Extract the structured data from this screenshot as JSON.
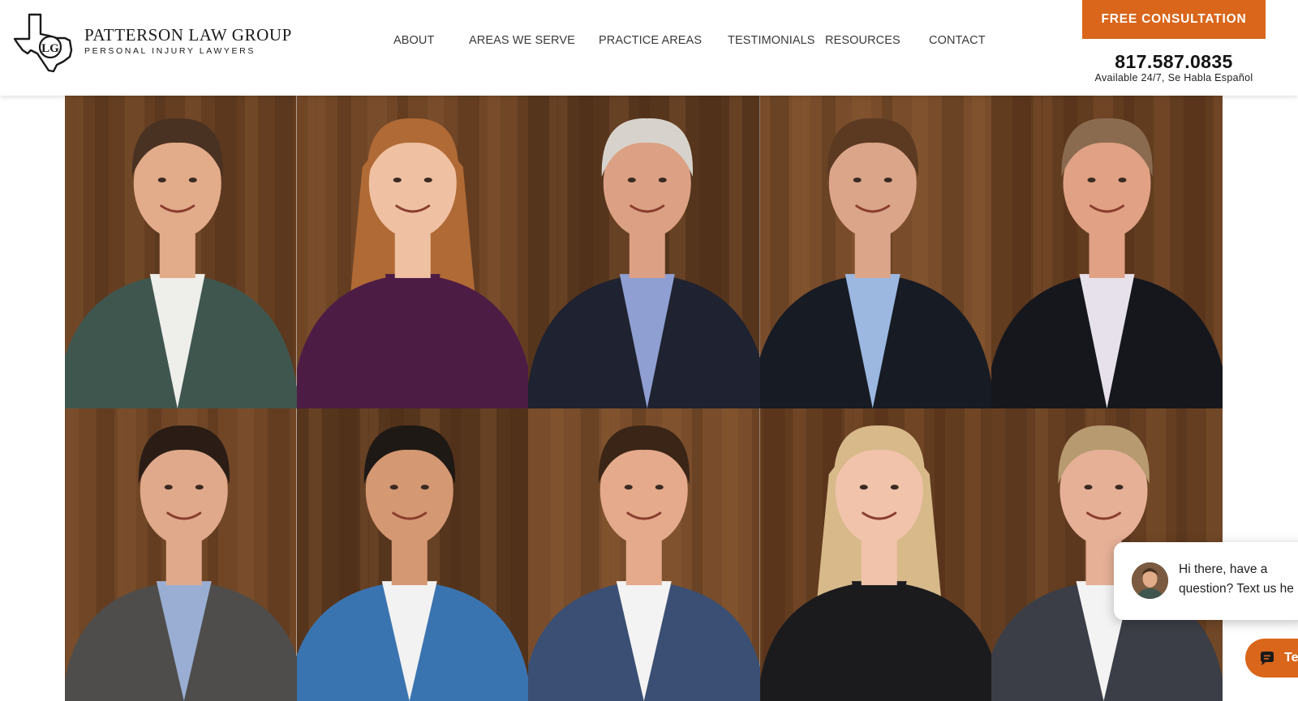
{
  "brand": {
    "name": "PATTERSON LAW GROUP",
    "tagline": "PERSONAL INJURY LAWYERS",
    "logo_monogram": "LG",
    "accent_color": "#d9661a"
  },
  "nav": {
    "items": [
      {
        "label": "ABOUT"
      },
      {
        "label": "AREAS WE SERVE"
      },
      {
        "label": "PRACTICE AREAS"
      },
      {
        "label": "TESTIMONIALS"
      },
      {
        "label": "RESOURCES"
      },
      {
        "label": "CONTACT"
      }
    ]
  },
  "header_cta": {
    "consult_label": "FREE CONSULTATION",
    "phone": "817.587.0835",
    "availability": "Available 24/7, Se Habla Español"
  },
  "team": {
    "photos": [
      {
        "suit": "#3f564f",
        "shirt": "#eeeeea",
        "hair": "#4a3222",
        "skin": "#e2ab8a",
        "long_hair": false
      },
      {
        "suit": "#4d1c45",
        "shirt": "#4d1c45",
        "hair": "#b06a35",
        "skin": "#efc1a2",
        "long_hair": true
      },
      {
        "suit": "#1f2230",
        "shirt": "#8f9fd2",
        "hair": "#d7d3cc",
        "skin": "#dca184",
        "long_hair": false
      },
      {
        "suit": "#161b24",
        "shirt": "#9cb8e1",
        "hair": "#5c3a22",
        "skin": "#dba58a",
        "long_hair": false
      },
      {
        "suit": "#15171d",
        "shirt": "#e6e1ea",
        "hair": "#8b6b4f",
        "skin": "#e0a184",
        "long_hair": false
      },
      {
        "suit": "#4f4d4b",
        "shirt": "#9aaed3",
        "hair": "#2b1d15",
        "skin": "#e0a98c",
        "long_hair": false
      },
      {
        "suit": "#3a74b0",
        "shirt": "#f2f2f2",
        "hair": "#1f1915",
        "skin": "#d49873",
        "long_hair": false
      },
      {
        "suit": "#3a4f73",
        "shirt": "#f3f3f3",
        "hair": "#3a2516",
        "skin": "#e4aa8b",
        "long_hair": false
      },
      {
        "suit": "#1b1b1e",
        "shirt": "#1b1b1e",
        "hair": "#d8b98a",
        "skin": "#f0c3aa",
        "long_hair": true
      },
      {
        "suit": "#3b3e46",
        "shirt": "#f3f3f3",
        "hair": "#b79a70",
        "skin": "#e6b097",
        "long_hair": false
      }
    ]
  },
  "chat": {
    "line1": "Hi there, have a",
    "line2": "question? Text us he",
    "button_label": "Te"
  }
}
